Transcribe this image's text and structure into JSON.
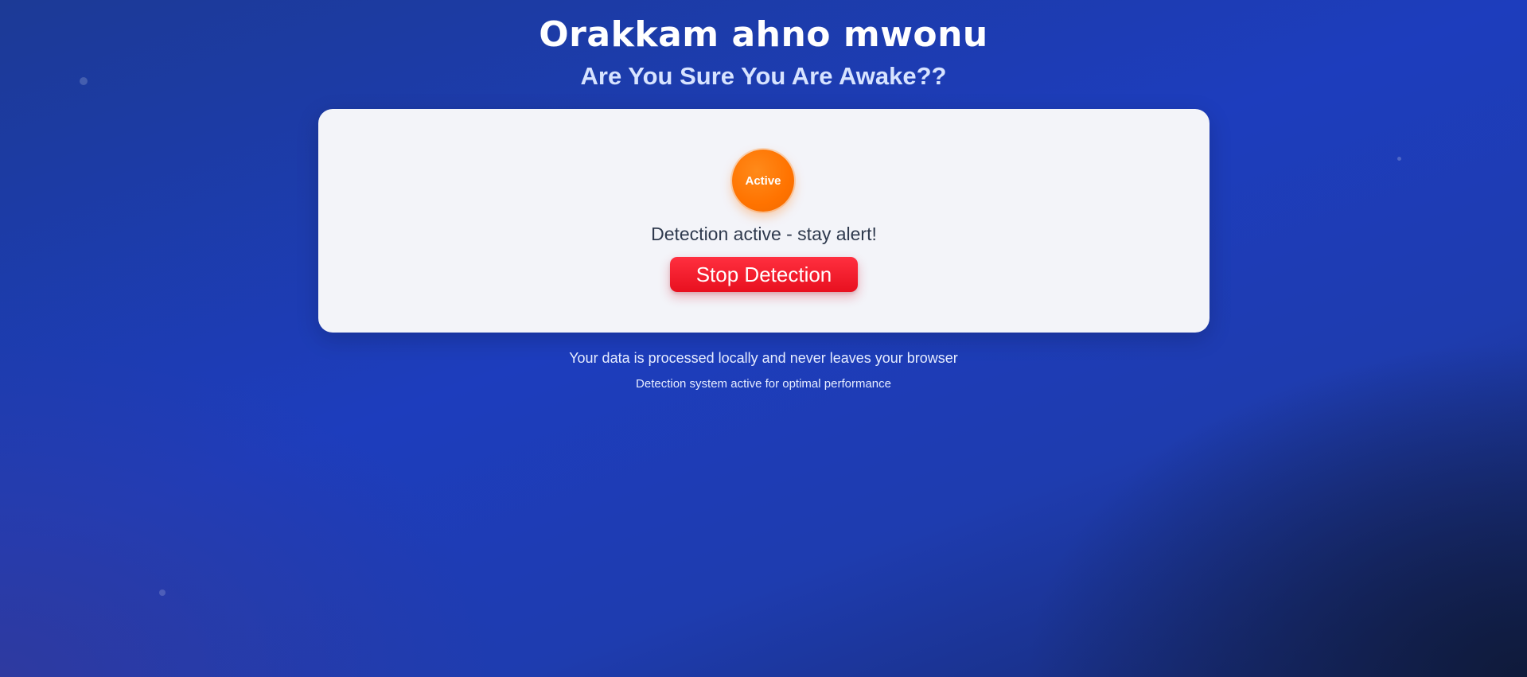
{
  "header": {
    "title": "Orakkam ahno mwonu",
    "subtitle": "Are You Sure You Are Awake??"
  },
  "card": {
    "status_badge": "Active",
    "status_color": "#ff7300",
    "status_message": "Detection active - stay alert!",
    "stop_button_label": "Stop Detection",
    "stop_button_color": "#ff2f3f"
  },
  "footer": {
    "privacy_note": "Your data is processed locally and never leaves your browser",
    "system_note": "Detection system active for optimal performance"
  }
}
